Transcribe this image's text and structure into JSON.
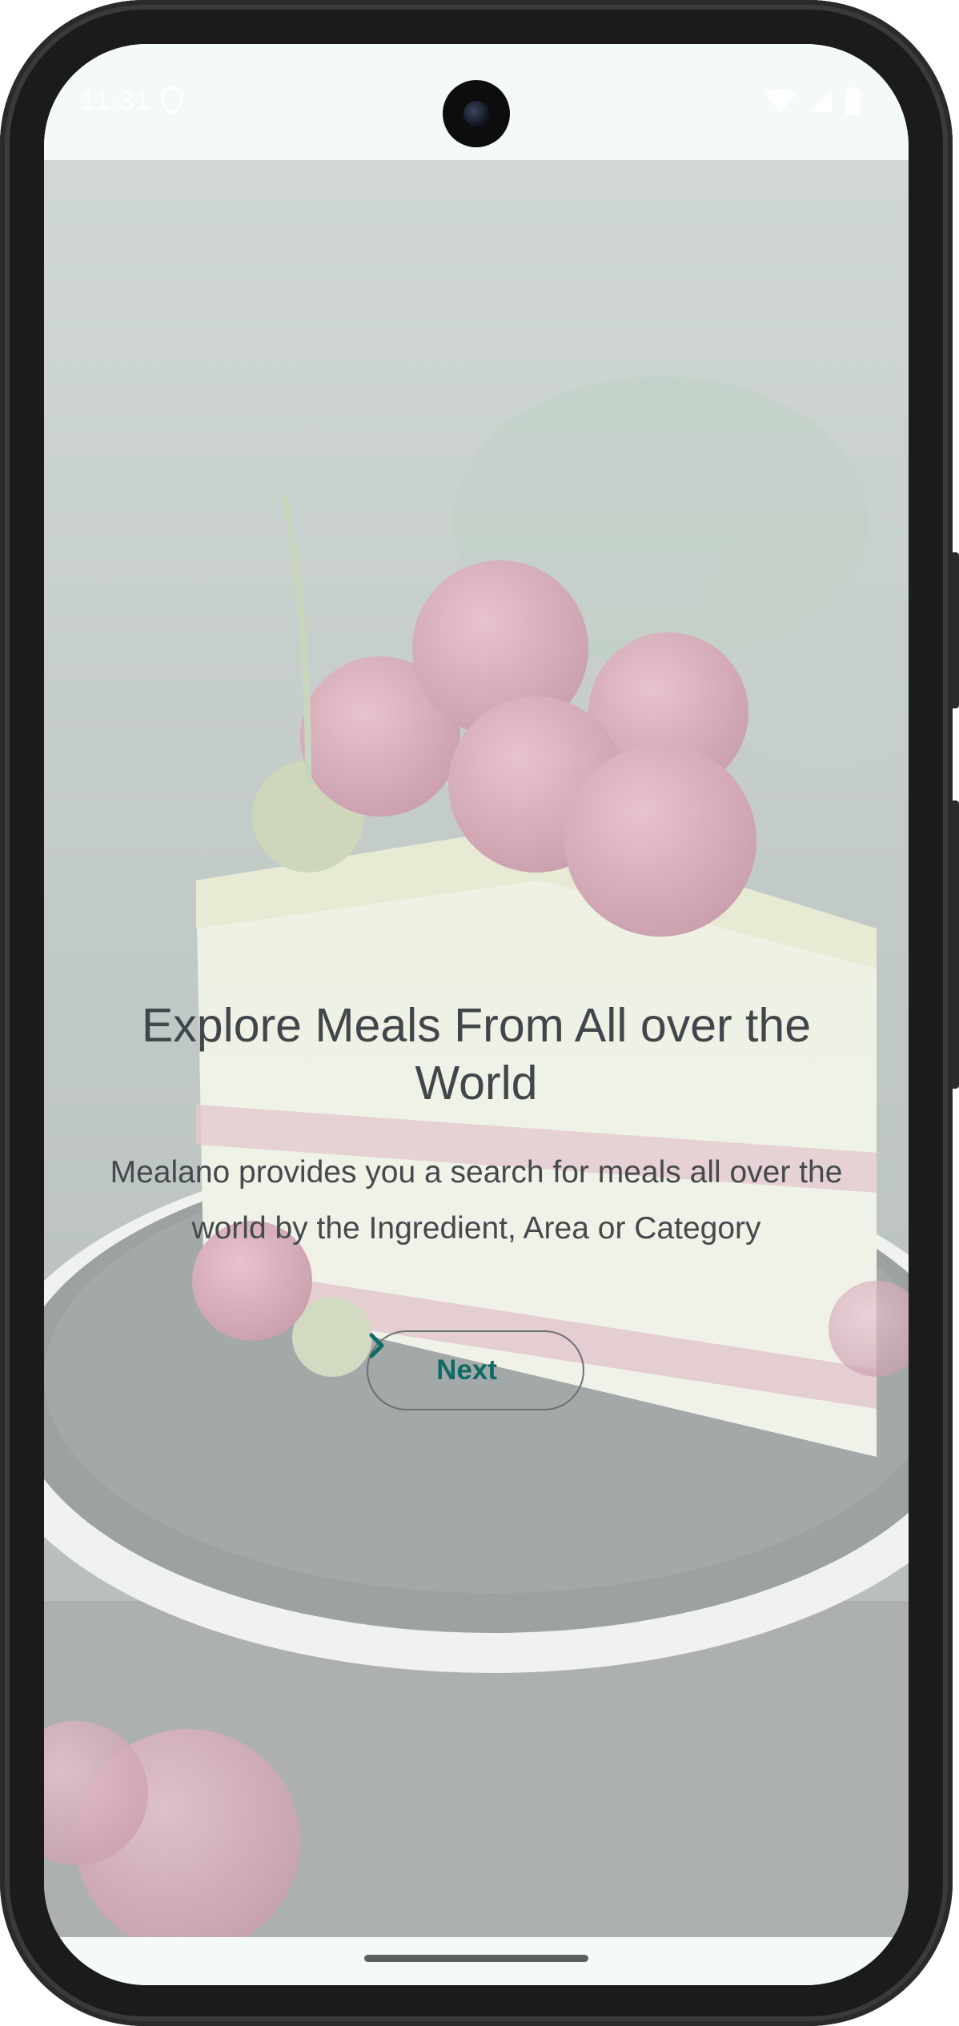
{
  "status_bar": {
    "time": "11:31",
    "shield_icon": "shield-icon",
    "wifi_icon": "wifi-icon",
    "signal_icon": "signal-icon",
    "battery_icon": "battery-icon"
  },
  "onboarding": {
    "background_image": "raspberry cake slice photo",
    "title": "Explore Meals From All over the World",
    "description": "Mealano provides you a search for meals all over the world by the Ingredient, Area or Category",
    "next_button": {
      "label": "Next",
      "icon": "chevron-right-icon"
    }
  },
  "colors": {
    "accent": "#0f6b63",
    "title_text": "#41464a",
    "body_text": "#45494d",
    "button_border": "#6b7170",
    "screen_bg": "#f4faf8"
  }
}
